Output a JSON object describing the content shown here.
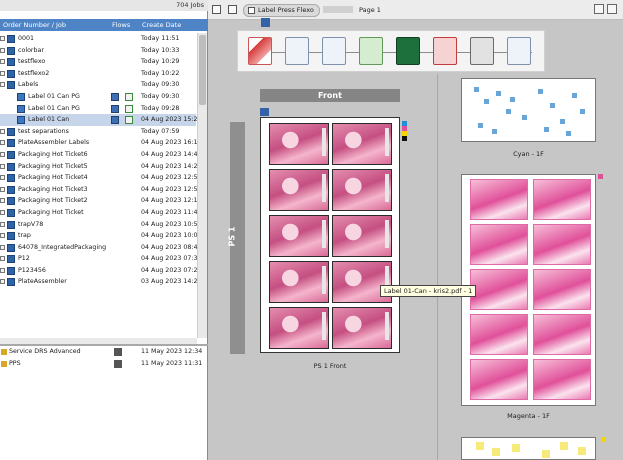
{
  "job_list": {
    "count_label": "704 Jobs",
    "columns": {
      "name": "Order Number / Job",
      "flows": "Flows",
      "date": "Create Date"
    },
    "rows": [
      {
        "name": "0001",
        "date": "Today 11:51"
      },
      {
        "name": "colorbar",
        "date": "Today 10:33"
      },
      {
        "name": "testflexo",
        "date": "Today 10:29"
      },
      {
        "name": "testflexo2",
        "date": "Today 10:22"
      },
      {
        "name": "Labels",
        "date": "Today 09:30"
      },
      {
        "name": "Label 01 Can PG",
        "date": "Today 09:30"
      },
      {
        "name": "Label 01 Can PG",
        "date": "Today 09:28"
      },
      {
        "name": "Label 01 Can",
        "date": "04 Aug 2023 15:2"
      },
      {
        "name": "test separations",
        "date": "Today 07:59"
      },
      {
        "name": "PlateAssembler Labels",
        "date": "04 Aug 2023 16:1"
      },
      {
        "name": "Packaging Hot Ticket6",
        "date": "04 Aug 2023 14:4"
      },
      {
        "name": "Packaging Hot Ticket5",
        "date": "04 Aug 2023 14:2"
      },
      {
        "name": "Packaging Hot Ticket4",
        "date": "04 Aug 2023 12:5"
      },
      {
        "name": "Packaging Hot Ticket3",
        "date": "04 Aug 2023 12:5"
      },
      {
        "name": "Packaging Hot Ticket2",
        "date": "04 Aug 2023 12:1"
      },
      {
        "name": "Packaging Hot Ticket",
        "date": "04 Aug 2023 11:4"
      },
      {
        "name": "trapV78",
        "date": "04 Aug 2023 10:5"
      },
      {
        "name": "trap",
        "date": "04 Aug 2023 10:0"
      },
      {
        "name": "64078_IntegratedPackaging",
        "date": "04 Aug 2023 08:4"
      },
      {
        "name": "P12",
        "date": "04 Aug 2023 07:3"
      },
      {
        "name": "P123456",
        "date": "04 Aug 2023 07:2"
      },
      {
        "name": "PlateAssembler",
        "date": "03 Aug 2023 14:2"
      }
    ],
    "services": [
      {
        "name": "Service DRS Advanced",
        "date": "11 May 2023 12:34"
      },
      {
        "name": "PPS",
        "date": "11 May 2023 11:31"
      }
    ]
  },
  "toolbar": {
    "press_tab": "Label Press Flexo",
    "page_label": "Page 1"
  },
  "layout": {
    "front_label": "Front",
    "ps_label": "PS 1",
    "ps_front_caption": "PS 1 Front",
    "tooltip": "Label 01-Can - kris2.pdf - 1",
    "cyan_caption": "Cyan - 1F",
    "magenta_caption": "Magenta - 1F"
  },
  "colors": {
    "header_blue": "#4e84c6",
    "selection": "#c6d5ea",
    "magenta": "#e0509a",
    "cyan": "#6aa5da",
    "yellow": "#f0d800"
  }
}
